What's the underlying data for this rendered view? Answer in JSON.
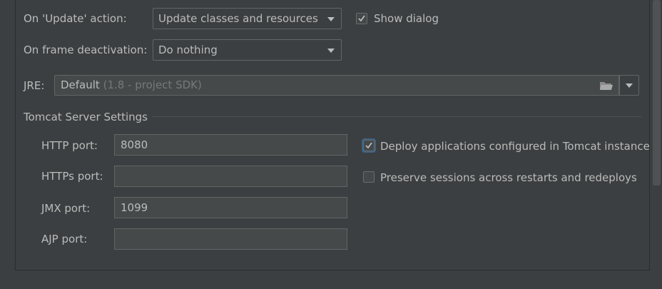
{
  "update_action": {
    "label": "On 'Update' action:",
    "selected": "Update classes and resources",
    "show_dialog_label": "Show dialog",
    "show_dialog_checked": true
  },
  "frame_deactivation": {
    "label": "On frame deactivation:",
    "selected": "Do nothing"
  },
  "jre": {
    "label": "JRE:",
    "value": "Default",
    "hint": "(1.8 - project SDK)"
  },
  "tomcat": {
    "section_title": "Tomcat Server Settings",
    "http_port_label": "HTTP port:",
    "http_port_value": "8080",
    "https_port_label": "HTTPs port:",
    "https_port_value": "",
    "jmx_port_label": "JMX port:",
    "jmx_port_value": "1099",
    "ajp_port_label": "AJP port:",
    "ajp_port_value": "",
    "deploy_label": "Deploy applications configured in Tomcat instance",
    "deploy_checked": true,
    "preserve_label": "Preserve sessions across restarts and redeploys",
    "preserve_checked": false
  },
  "colors": {
    "background": "#3c3f41",
    "text": "#bbbbbb",
    "field_bg": "#45494a",
    "border": "#646464",
    "focus": "#3d6185"
  }
}
